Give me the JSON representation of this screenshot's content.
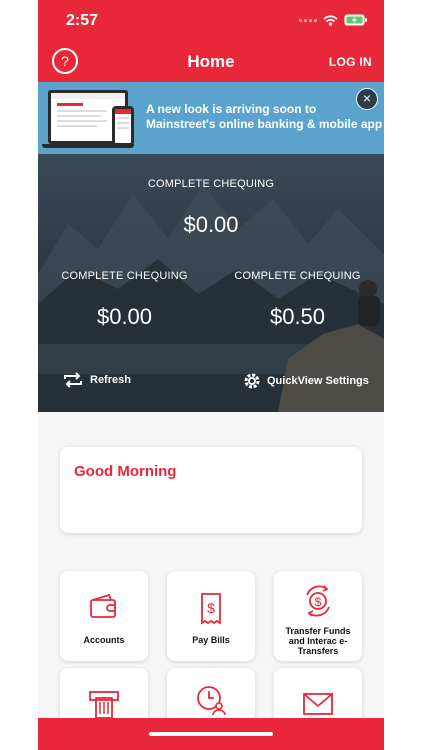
{
  "status": {
    "time": "2:57"
  },
  "header": {
    "title": "Home",
    "help": "?",
    "login": "LOG IN"
  },
  "banner": {
    "text": "A new look is arriving soon to Mainstreet's online banking & mobile app",
    "close": "×"
  },
  "quickview": {
    "accounts": [
      {
        "name": "COMPLETE CHEQUING",
        "balance": "$0.00"
      },
      {
        "name": "COMPLETE CHEQUING",
        "balance": "$0.00"
      },
      {
        "name": "COMPLETE CHEQUING",
        "balance": "$0.50"
      }
    ],
    "refresh": "Refresh",
    "settings": "QuickView Settings"
  },
  "greeting": "Good Morning",
  "tiles": [
    {
      "label": "Accounts",
      "icon": "wallet-icon"
    },
    {
      "label": "Pay Bills",
      "icon": "bill-icon"
    },
    {
      "label": "Transfer Funds and Interac e-Transfers",
      "icon": "transfer-icon"
    },
    {
      "label": "",
      "icon": "atm-icon"
    },
    {
      "label": "",
      "icon": "clock-person-icon"
    },
    {
      "label": "",
      "icon": "envelope-icon"
    }
  ],
  "colors": {
    "brand": "#e8283a",
    "banner": "#5aa3cc"
  }
}
